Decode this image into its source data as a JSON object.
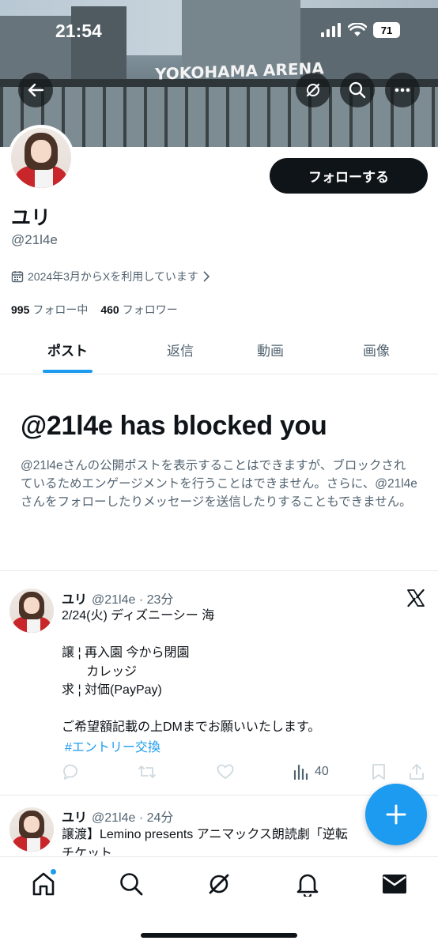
{
  "status_bar": {
    "time": "21:54",
    "battery": "71"
  },
  "banner": {
    "sign_text": "YOKOHAMA ARENA"
  },
  "header_buttons": {
    "back": "back-arrow-icon",
    "grok": "grok-icon",
    "search": "search-icon",
    "more": "more-icon"
  },
  "profile": {
    "follow_label": "フォローする",
    "name": "ユリ",
    "handle": "@21l4e",
    "joined": "2024年3月からXを利用しています",
    "following_count": "995",
    "following_label": "フォロー中",
    "followers_count": "460",
    "followers_label": "フォロワー"
  },
  "tabs": [
    "ポスト",
    "返信",
    "動画",
    "画像"
  ],
  "blocked": {
    "title": "@21l4e has blocked you",
    "text": "@21l4eさんの公開ポストを表示することはできますが、ブロックされているためエンゲージメントを行うことはできません。さらに、@21l4eさんをフォローしたりメッセージを送信したりすることもできません。"
  },
  "posts": [
    {
      "name": "ユリ",
      "meta": "@21l4e · 23分",
      "body": "2/24(火) ディズニーシー 海\n\n譲 ¦ 再入園 今から閉園\n       カレッジ\n求 ¦ 対価(PayPay)\n\nご希望額記載の上DMまでお願いいたします。",
      "hashtag": "#エントリー交換",
      "views": "40"
    },
    {
      "name": "ユリ",
      "meta": "@21l4e · 24分",
      "body": "譲渡】Lemino presents アニマックス朗読劇「逆転\nチケット"
    }
  ],
  "colors": {
    "accent": "#1d9bf0",
    "text": "#0f1419",
    "secondary": "#536471"
  }
}
